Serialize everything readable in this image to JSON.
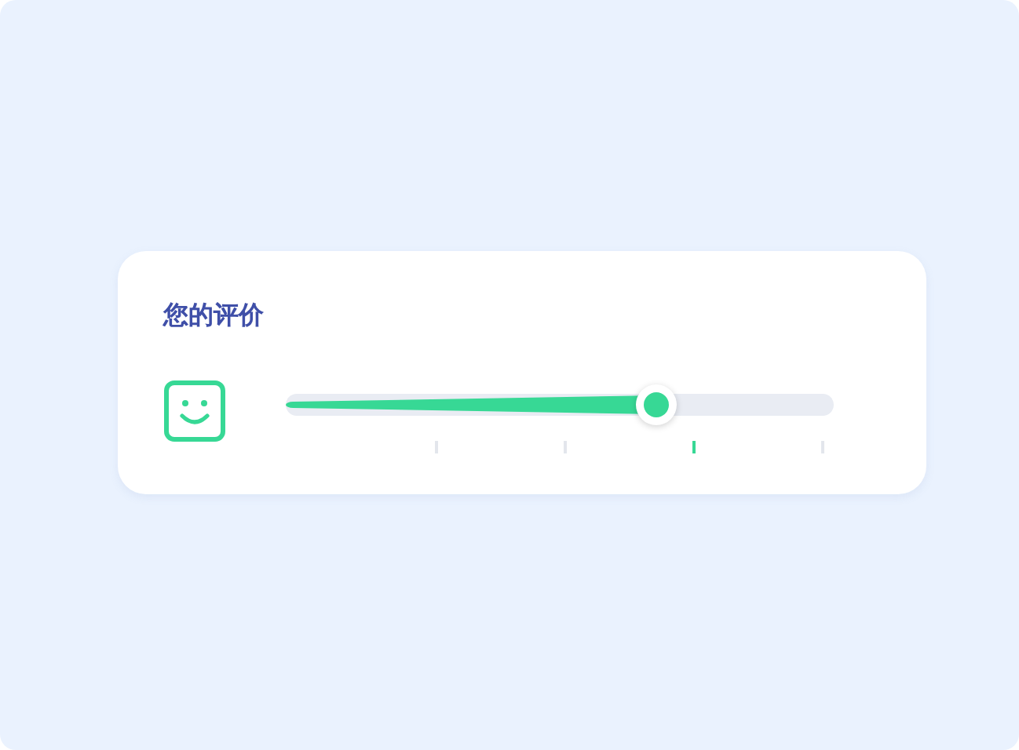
{
  "card": {
    "title": "您的评价",
    "slider": {
      "level": 0.676
    },
    "ticks": [
      {
        "selected": false
      },
      {
        "selected": false
      },
      {
        "selected": true
      },
      {
        "selected": false
      }
    ]
  }
}
